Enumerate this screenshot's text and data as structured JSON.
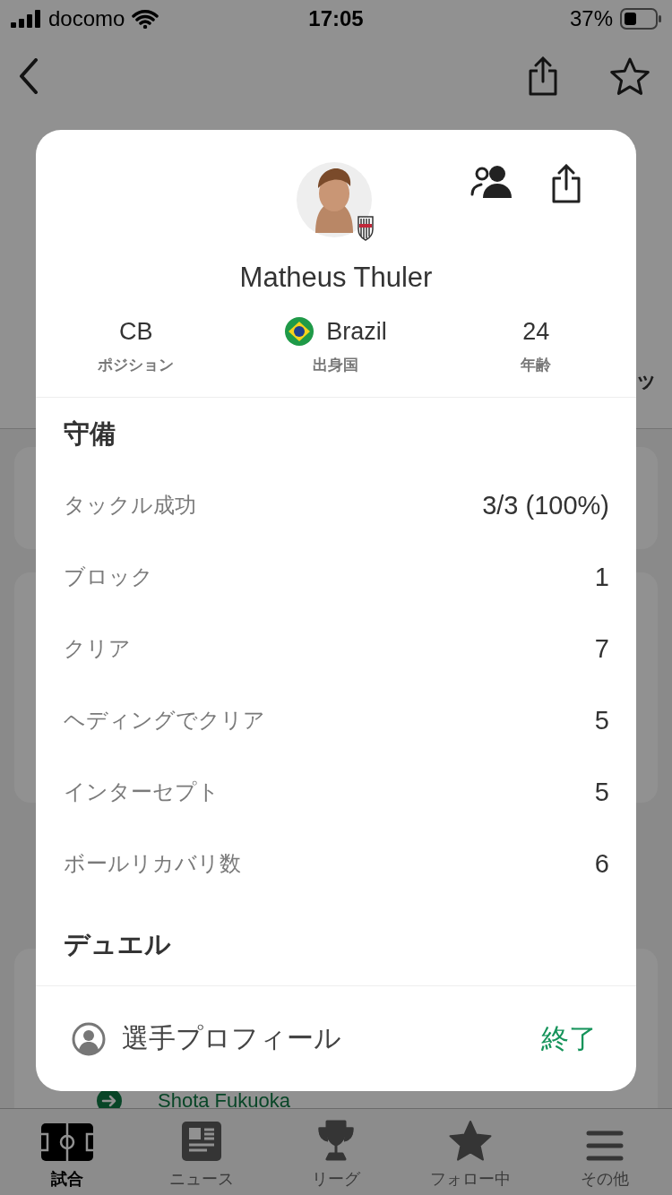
{
  "status_bar": {
    "carrier": "docomo",
    "time": "17:05",
    "battery": "37%"
  },
  "background": {
    "tab_fragment": "ッ",
    "row_name": "Shota Fukuoka"
  },
  "player": {
    "name": "Matheus Thuler",
    "facts": [
      {
        "kind": "text",
        "value": "CB",
        "label": "ポジション"
      },
      {
        "kind": "country",
        "value": "Brazil",
        "label": "出身国"
      },
      {
        "kind": "text",
        "value": "24",
        "label": "年齢"
      }
    ]
  },
  "sections": [
    {
      "title": "守備",
      "rows": [
        {
          "label": "タックル成功",
          "value": "3/3 (100%)"
        },
        {
          "label": "ブロック",
          "value": "1"
        },
        {
          "label": "クリア",
          "value": "7"
        },
        {
          "label": "ヘディングでクリア",
          "value": "5"
        },
        {
          "label": "インターセプト",
          "value": "5"
        },
        {
          "label": "ボールリカバリ数",
          "value": "6"
        }
      ]
    },
    {
      "title": "デュエル"
    }
  ],
  "footer": {
    "profile_label": "選手プロフィール",
    "close_label": "終了"
  },
  "tab_bar": [
    {
      "label": "試合",
      "kind": "match",
      "selected": true
    },
    {
      "label": "ニュース",
      "kind": "news",
      "selected": false
    },
    {
      "label": "リーグ",
      "kind": "league",
      "selected": false
    },
    {
      "label": "フォロー中",
      "kind": "following",
      "selected": false
    },
    {
      "label": "その他",
      "kind": "more",
      "selected": false
    }
  ]
}
